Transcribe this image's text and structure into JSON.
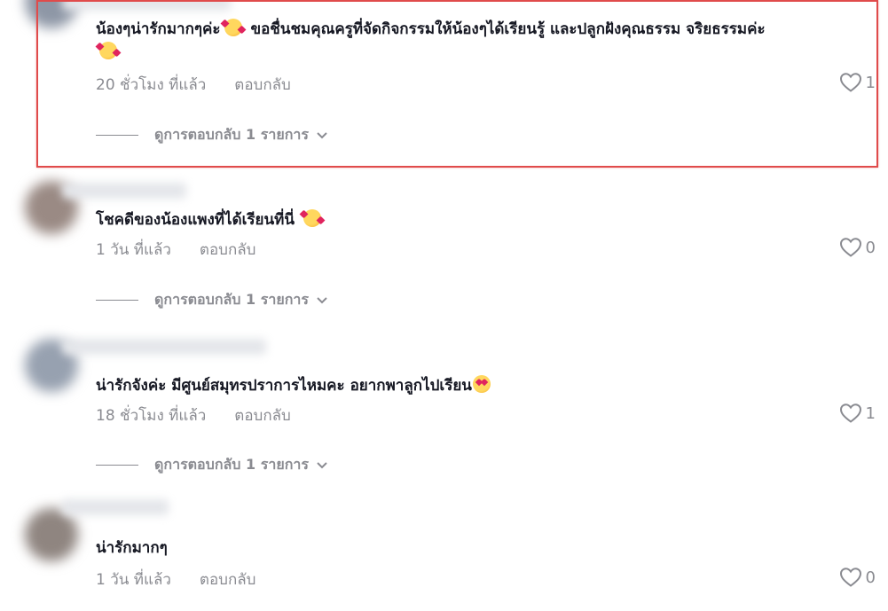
{
  "comments": [
    {
      "text_a": "น้องๆน่ารักมากๆค่ะ",
      "emoji_a": "smiling-face-with-hearts",
      "text_b": "ขอชื่นชมคุณครูที่จัดกิจกรรมให้น้องๆได้เรียนรู้ และปลูกฝังคุณธรรม จริยธรรมค่ะ",
      "emoji_b": "smiling-face-with-hearts",
      "time": "20 ชั่วโมง ที่แล้ว",
      "reply_label": "ตอบกลับ",
      "likes": "1",
      "view_replies": "ดูการตอบกลับ 1 รายการ",
      "highlighted": true
    },
    {
      "text_a": "โชคดีของน้องแพงที่ได้เรียนที่นี่",
      "emoji_a": "smiling-face-with-hearts",
      "time": "1 วัน ที่แล้ว",
      "reply_label": "ตอบกลับ",
      "likes": "0",
      "view_replies": "ดูการตอบกลับ 1 รายการ"
    },
    {
      "text_a": "น่ารักจังค่ะ มีศูนย์สมุทรปราการไหมคะ อยากพาลูกไปเรียน",
      "emoji_a": "smiling-face-with-heart-eyes",
      "time": "18 ชั่วโมง ที่แล้ว",
      "reply_label": "ตอบกลับ",
      "likes": "1",
      "view_replies": "ดูการตอบกลับ 1 รายการ"
    },
    {
      "text_a": "น่ารักมากๆ",
      "time": "1 วัน ที่แล้ว",
      "reply_label": "ตอบกลับ",
      "likes": "0"
    }
  ],
  "colors": {
    "highlight_border": "#e04b4b",
    "muted_text": "#8a8b91",
    "primary_text": "#161823"
  },
  "icons": {
    "like": "heart-outline-icon",
    "expand": "chevron-down-icon"
  }
}
